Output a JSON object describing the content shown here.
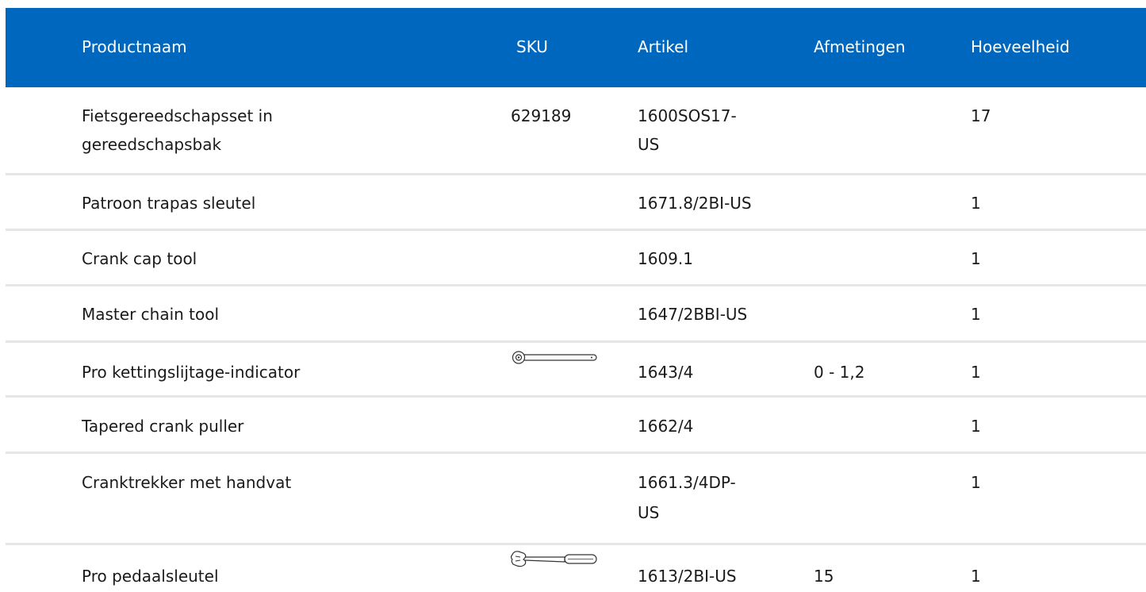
{
  "table": {
    "headers": {
      "name": "Productnaam",
      "sku": "SKU",
      "article": "Artikel",
      "dimensions": "Afmetingen",
      "quantity": "Hoeveelheid"
    },
    "rows": [
      {
        "name_line1": "Fietsgereedschapsset in",
        "name_line2": "gereedschapsbak",
        "sku": "629189",
        "article_line1": "1600SOS17-",
        "article_line2": "US",
        "dimensions": "",
        "quantity": "17",
        "image": ""
      },
      {
        "name": "Patroon trapas sleutel",
        "sku": "",
        "article": "1671.8/2BI-US",
        "dimensions": "",
        "quantity": "1",
        "image": ""
      },
      {
        "name": "Crank cap tool",
        "sku": "",
        "article": "1609.1",
        "dimensions": "",
        "quantity": "1",
        "image": ""
      },
      {
        "name": "Master chain tool",
        "sku": "",
        "article": "1647/2BBI-US",
        "dimensions": "",
        "quantity": "1",
        "image": ""
      },
      {
        "name": "Pro kettingslijtage-indicator",
        "sku": "",
        "article": "1643/4",
        "dimensions": "0 - 1,2",
        "quantity": "1",
        "image": "chain-wear-indicator-icon"
      },
      {
        "name": "Tapered crank puller",
        "sku": "",
        "article": "1662/4",
        "dimensions": "",
        "quantity": "1",
        "image": ""
      },
      {
        "name": "Cranktrekker met handvat",
        "sku": "",
        "article_line1": "1661.3/4DP-",
        "article_line2": "US",
        "dimensions": "",
        "quantity": "1",
        "image": ""
      },
      {
        "name": "Pro pedaalsleutel",
        "sku": "",
        "article": "1613/2BI-US",
        "dimensions": "15",
        "quantity": "1",
        "image": "pedal-wrench-icon"
      }
    ]
  },
  "colors": {
    "header_bg": "#0067bf",
    "header_text": "#ffffff",
    "separator": "#e6e6e6"
  }
}
